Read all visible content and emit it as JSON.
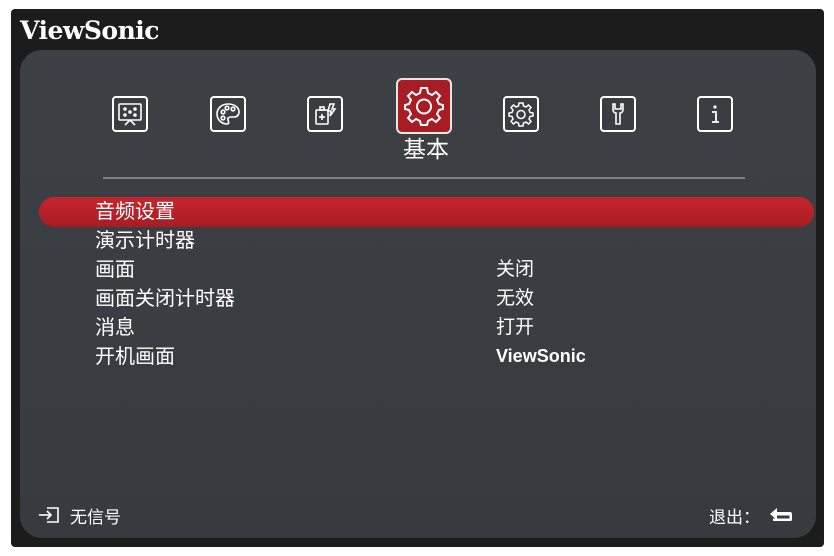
{
  "brand": {
    "name": "ViewSonic"
  },
  "toolbar": {
    "tabs": [
      {
        "id": "display",
        "icon": "display-icon"
      },
      {
        "id": "image",
        "icon": "palette-icon"
      },
      {
        "id": "power",
        "icon": "power-management-icon"
      },
      {
        "id": "basic",
        "icon": "gear-icon",
        "label": "基本",
        "active": true
      },
      {
        "id": "advanced",
        "icon": "advanced-gear-icon"
      },
      {
        "id": "system",
        "icon": "wrench-icon"
      },
      {
        "id": "info",
        "icon": "info-icon"
      }
    ]
  },
  "menu": {
    "items": [
      {
        "label": "音频设置",
        "value": ""
      },
      {
        "label": "演示计时器",
        "value": ""
      },
      {
        "label": "画面",
        "value": "关闭"
      },
      {
        "label": "画面关闭计时器",
        "value": "无效"
      },
      {
        "label": "消息",
        "value": "打开"
      },
      {
        "label": "开机画面",
        "value": "ViewSonic"
      }
    ],
    "selected_index": 0
  },
  "footer": {
    "source_icon": "input-source-icon",
    "signal_status": "无信号",
    "exit_label": "退出：",
    "exit_icon": "return-arrow-icon"
  },
  "colors": {
    "highlight": "#a81d24",
    "panel": "#3a3e42",
    "frame": "#1c1c1c",
    "text": "#ffffff"
  }
}
